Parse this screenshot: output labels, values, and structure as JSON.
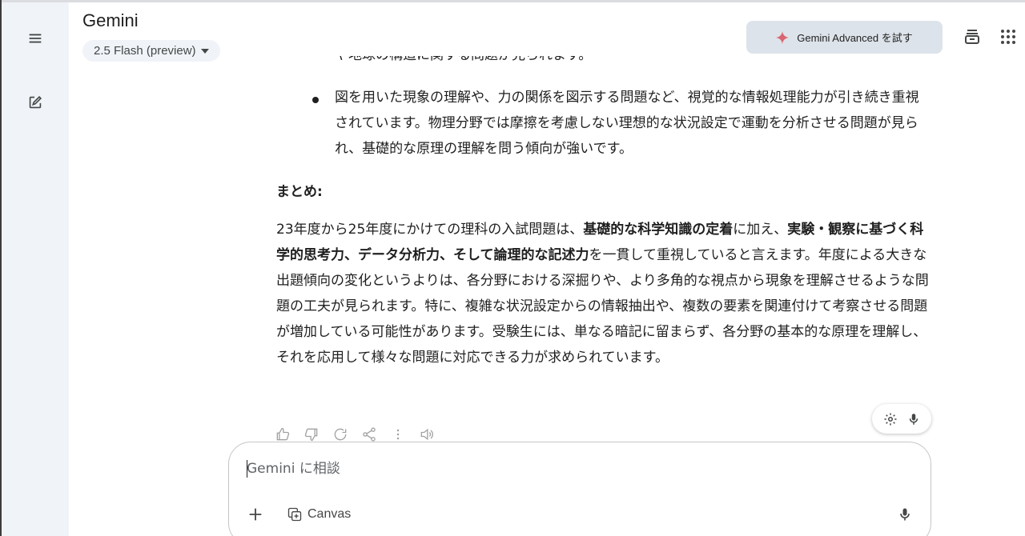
{
  "header": {
    "title": "Gemini",
    "model_selector": "2.5 Flash (preview)",
    "advanced_button": "Gemini Advanced を試す"
  },
  "icons": {
    "menu": "menu-icon",
    "new_chat": "edit-icon",
    "history": "history-icon",
    "apps": "apps-grid-icon",
    "sparkle": "sparkle-icon",
    "settings": "gear-icon",
    "mic": "mic-icon"
  },
  "colors": {
    "sidebar_bg": "#f0f4f9",
    "accent_sparkle": "#d96570",
    "advanced_bg": "#dde3ea"
  },
  "response": {
    "cut_line": "や地球の構造に関する問題が見られます。",
    "bullet_text": "図を用いた現象の理解や、力の関係を図示する問題など、視覚的な情報処理能力が引き続き重視されています。物理分野では摩擦を考慮しない理想的な状況設定で運動を分析させる問題が見られ、基礎的な原理の理解を問う傾向が強いです。",
    "summary_heading": "まとめ:",
    "summary_parts": {
      "p1": "23年度から25年度にかけての理科の入試問題は、",
      "b1": "基礎的な科学知識の定着",
      "p2": "に加え、",
      "b2": "実験・観察に基づく科学的思考力、データ分析力、そして論理的な記述力",
      "p3": "を一貫して重視していると言えます。年度による大きな出題傾向の変化というよりは、各分野における深掘りや、より多角的な視点から現象を理解させるような問題の工夫が見られます。特に、複雑な状況設定からの情報抽出や、複数の要素を関連付けて考察させる問題が増加している可能性があります。受験生には、単なる暗記に留まらず、各分野の基本的な原理を理解し、それを応用して様々な問題に対応できる力が求められています。"
    }
  },
  "composer": {
    "placeholder": "Gemini に相談",
    "canvas_label": "Canvas"
  }
}
